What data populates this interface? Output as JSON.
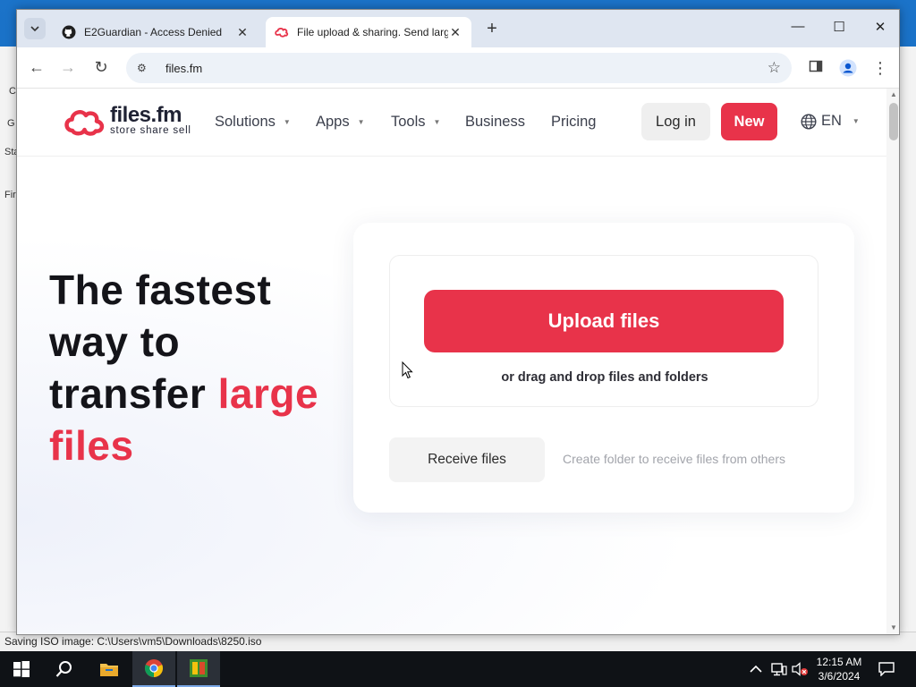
{
  "desktop": {
    "behind_window_strips": [
      "C",
      "G",
      "Sta",
      "Fir"
    ],
    "status_text": "Saving ISO image: C:\\Users\\vm5\\Downloads\\8250.iso"
  },
  "browser": {
    "tabs": [
      {
        "title": "E2Guardian - Access Denied",
        "icon": "github-icon",
        "active": false
      },
      {
        "title": "File upload & sharing. Send large files",
        "icon": "filesfm-icon",
        "active": true
      }
    ],
    "new_tab_symbol": "+",
    "address": "files.fm",
    "window_controls": {
      "minimize": "—",
      "maximize": "☐",
      "close": "✕"
    }
  },
  "site": {
    "logo": {
      "name": "files.fm",
      "tagline": "store  share  sell",
      "color": "#e8334a"
    },
    "menu": [
      {
        "label": "Solutions",
        "has_dropdown": true
      },
      {
        "label": "Apps",
        "has_dropdown": true
      },
      {
        "label": "Tools",
        "has_dropdown": true
      },
      {
        "label": "Business",
        "has_dropdown": false
      },
      {
        "label": "Pricing",
        "has_dropdown": false
      }
    ],
    "login_label": "Log in",
    "new_label": "New",
    "language": "EN",
    "accent_color": "#e8334a"
  },
  "hero": {
    "headline_line1": "The fastest",
    "headline_line2": "way to",
    "headline_line3_prefix": "transfer ",
    "headline_accent1": "large",
    "headline_accent2": "files",
    "upload_label": "Upload files",
    "drag_hint": "or drag and drop files and folders",
    "receive_label": "Receive files",
    "receive_hint": "Create folder to receive files from others"
  },
  "taskbar": {
    "time": "12:15 AM",
    "date": "3/6/2024",
    "apps": [
      "start-icon",
      "search-icon",
      "file-explorer-icon",
      "chrome-icon",
      "app-icon"
    ]
  }
}
